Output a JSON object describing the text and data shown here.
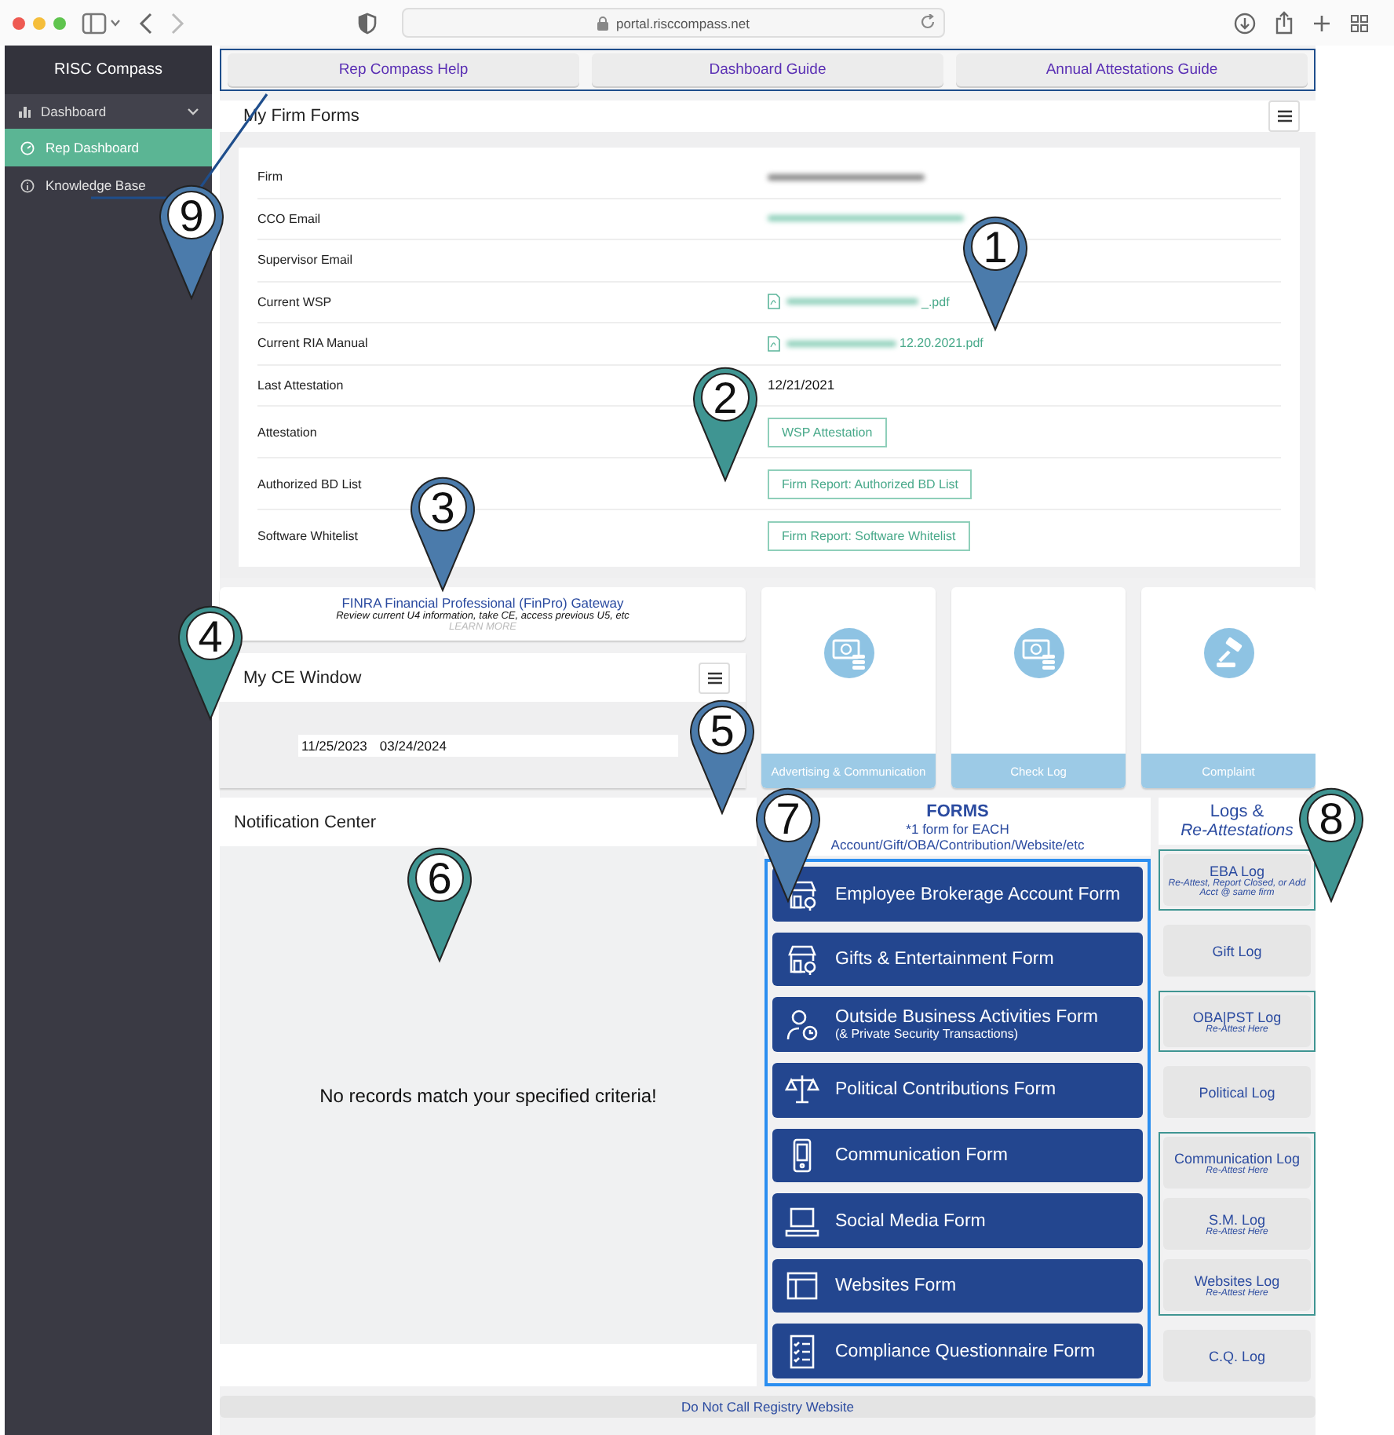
{
  "browser": {
    "url": "portal.risccompass.net"
  },
  "sidebar": {
    "title": "RISC Compass",
    "items": [
      {
        "label": "Dashboard",
        "expanded": true,
        "children": [
          {
            "label": "Rep Dashboard",
            "selected": true
          },
          {
            "label": "Knowledge Base",
            "selected": false
          }
        ]
      }
    ]
  },
  "help_links": [
    "Rep Compass Help",
    "Dashboard Guide",
    "Annual Attestations Guide"
  ],
  "firm_forms": {
    "title": "My Firm Forms",
    "rows": [
      {
        "label": "Firm",
        "kind": "redacted"
      },
      {
        "label": "CCO Email",
        "kind": "redacted_link"
      },
      {
        "label": "Supervisor Email",
        "kind": "empty"
      },
      {
        "label": "Current WSP",
        "kind": "file",
        "value": "_.pdf"
      },
      {
        "label": "Current RIA Manual",
        "kind": "file",
        "value": "12.20.2021.pdf"
      },
      {
        "label": "Last Attestation",
        "kind": "text",
        "value": "12/21/2021"
      },
      {
        "label": "Attestation",
        "kind": "button",
        "value": "WSP Attestation"
      },
      {
        "label": "Authorized BD List",
        "kind": "button",
        "value": "Firm Report: Authorized BD List"
      },
      {
        "label": "Software Whitelist",
        "kind": "button",
        "value": "Firm Report: Software Whitelist"
      }
    ]
  },
  "finpro": {
    "title": "FINRA Financial Professional (FinPro) Gateway",
    "subtitle": "Review current U4 information, take CE, access previous U5, etc",
    "more": "LEARN MORE"
  },
  "ce_window": {
    "title": "My CE Window",
    "start": "11/25/2023",
    "end": "03/24/2024"
  },
  "tiles": [
    {
      "label": "Advertising & Communication"
    },
    {
      "label": "Check Log"
    },
    {
      "label": "Complaint"
    }
  ],
  "notifications": {
    "title": "Notification Center",
    "empty": "No records match your specified criteria!"
  },
  "forms": {
    "title": "FORMS",
    "note": "*1 form for EACH",
    "note2": "Account/Gift/OBA/Contribution/Website/etc",
    "items": [
      {
        "label": "Employee Brokerage Account Form"
      },
      {
        "label": "Gifts & Entertainment Form"
      },
      {
        "label": "Outside Business Activities Form",
        "sub": "(& Private Security Transactions)"
      },
      {
        "label": "Political Contributions Form"
      },
      {
        "label": "Communication Form"
      },
      {
        "label": "Social Media Form"
      },
      {
        "label": "Websites Form"
      },
      {
        "label": "Compliance Questionnaire Form"
      }
    ]
  },
  "logs": {
    "title": "Logs &",
    "title2": "Re-Attestations",
    "groups": [
      {
        "highlighted": true,
        "items": [
          {
            "label": "EBA Log",
            "sub": "Re-Attest, Report Closed, or Add Acct @ same firm"
          }
        ]
      },
      {
        "highlighted": false,
        "items": [
          {
            "label": "Gift Log"
          }
        ]
      },
      {
        "highlighted": true,
        "items": [
          {
            "label": "OBA|PST Log",
            "sub": "Re-Attest Here"
          }
        ]
      },
      {
        "highlighted": false,
        "items": [
          {
            "label": "Political Log"
          }
        ]
      },
      {
        "highlighted": true,
        "items": [
          {
            "label": "Communication Log",
            "sub": "Re-Attest Here"
          },
          {
            "label": "S.M. Log",
            "sub": "Re-Attest Here"
          },
          {
            "label": "Websites Log",
            "sub": "Re-Attest Here"
          }
        ]
      },
      {
        "highlighted": false,
        "items": [
          {
            "label": "C.Q. Log"
          }
        ]
      }
    ]
  },
  "footer_link": "Do Not Call Registry Website",
  "annotations": [
    {
      "number": "1",
      "color": "#4b7bab"
    },
    {
      "number": "2",
      "color": "#3f9592"
    },
    {
      "number": "3",
      "color": "#4b7bab"
    },
    {
      "number": "4",
      "color": "#3f9592"
    },
    {
      "number": "5",
      "color": "#4b7bab"
    },
    {
      "number": "6",
      "color": "#3f9592"
    },
    {
      "number": "7",
      "color": "#4b7bab"
    },
    {
      "number": "8",
      "color": "#3f9592"
    },
    {
      "number": "9",
      "color": "#4b7bab"
    }
  ]
}
